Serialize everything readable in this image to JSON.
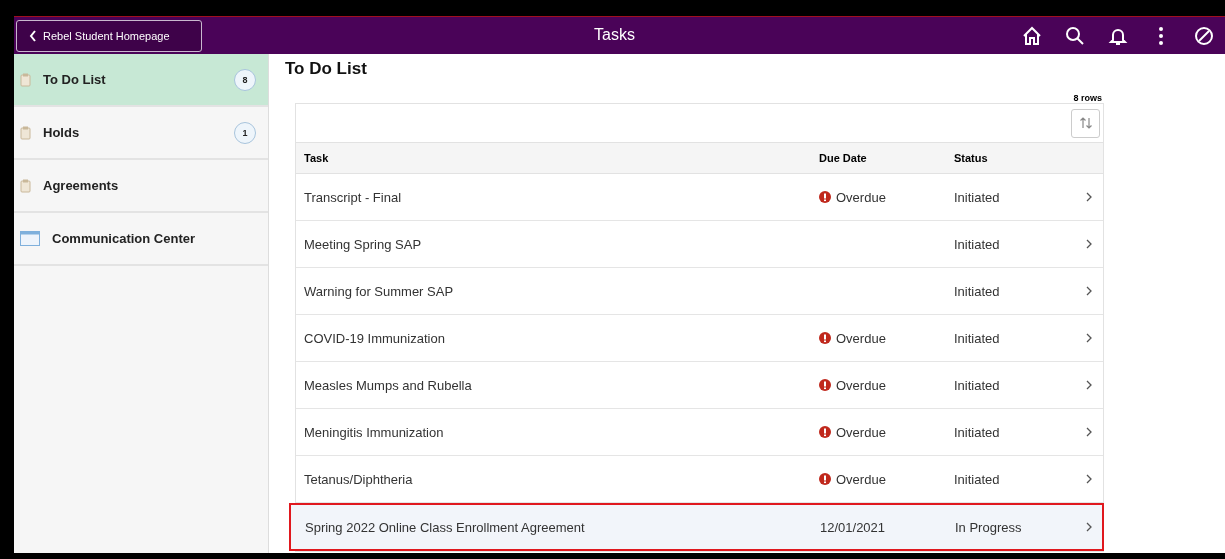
{
  "header": {
    "back_button": "Rebel Student Homepage",
    "title": "Tasks"
  },
  "sidebar": {
    "items": [
      {
        "label": "To Do List",
        "badge": "8",
        "selected": true,
        "kind": "clipboard"
      },
      {
        "label": "Holds",
        "badge": "1",
        "selected": false,
        "kind": "clipboard"
      },
      {
        "label": "Agreements",
        "selected": false,
        "kind": "clipboard"
      },
      {
        "label": "Communication Center",
        "selected": false,
        "kind": "window"
      }
    ]
  },
  "main": {
    "title": "To Do List",
    "row_count": "8 rows",
    "table": {
      "columns": [
        "Task",
        "Due Date",
        "Status"
      ],
      "rows": [
        {
          "task": "Transcript - Final",
          "due": "Overdue",
          "overdue": true,
          "status": "Initiated",
          "highlighted": false
        },
        {
          "task": "Meeting Spring SAP",
          "overdue": false,
          "status": "Initiated",
          "highlighted": false
        },
        {
          "task": "Warning for Summer SAP",
          "overdue": false,
          "status": "Initiated",
          "highlighted": false
        },
        {
          "task": "COVID-19 Immunization",
          "due": "Overdue",
          "overdue": true,
          "status": "Initiated",
          "highlighted": false
        },
        {
          "task": "Measles Mumps and Rubella",
          "due": "Overdue",
          "overdue": true,
          "status": "Initiated",
          "highlighted": false
        },
        {
          "task": "Meningitis Immunization",
          "due": "Overdue",
          "overdue": true,
          "status": "Initiated",
          "highlighted": false
        },
        {
          "task": "Tetanus/Diphtheria",
          "due": "Overdue",
          "overdue": true,
          "status": "Initiated",
          "highlighted": false
        },
        {
          "task": "Spring 2022 Online Class Enrollment Agreement",
          "due": "12/01/2021",
          "overdue": false,
          "status": "In Progress",
          "highlighted": true
        }
      ]
    }
  }
}
